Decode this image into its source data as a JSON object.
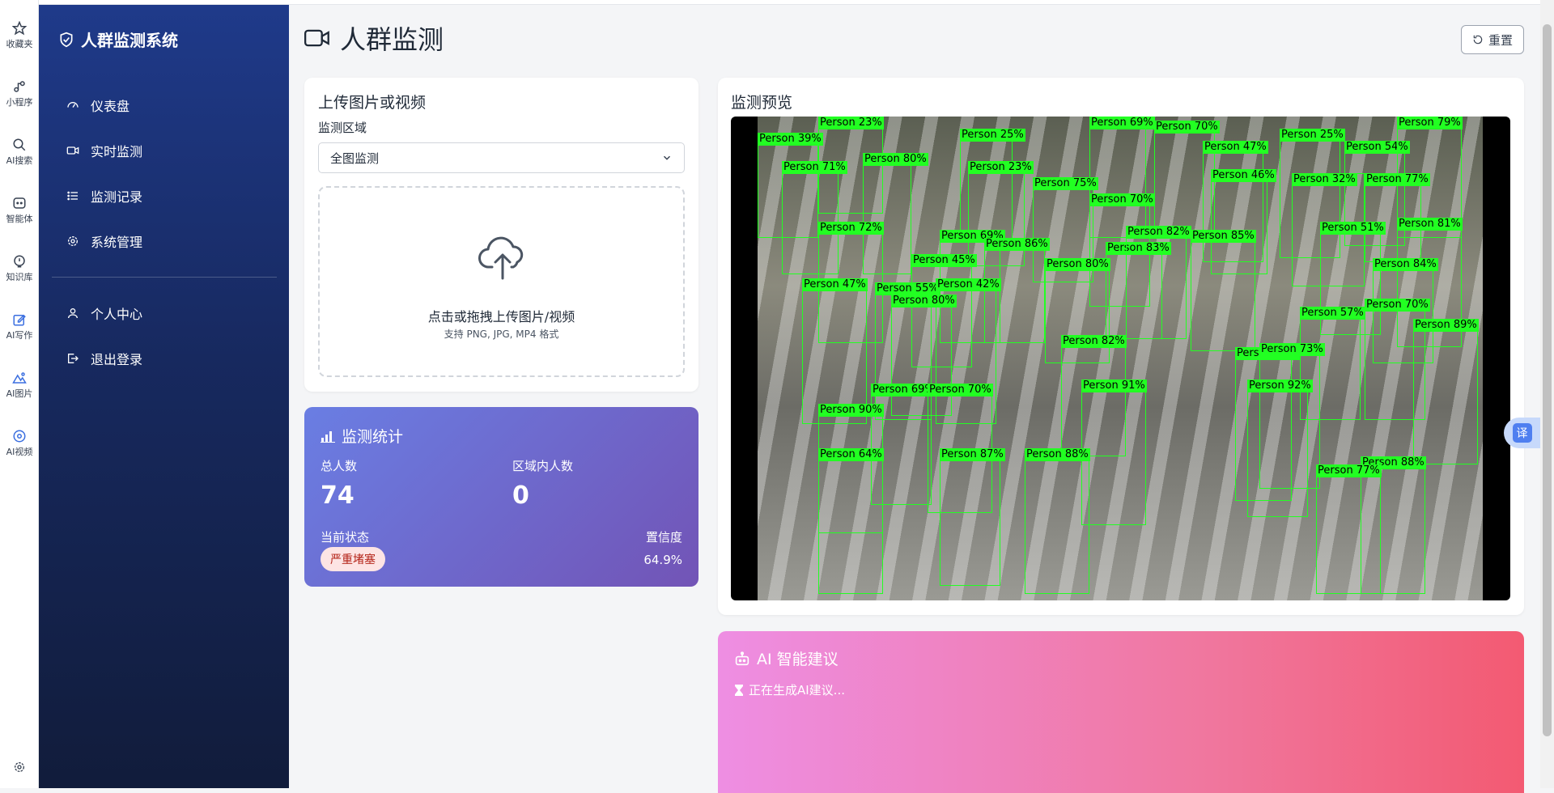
{
  "rail": {
    "items": [
      {
        "label": "收藏夹",
        "icon": "star-icon"
      },
      {
        "label": "小程序",
        "icon": "miniprogram-icon"
      },
      {
        "label": "AI搜索",
        "icon": "search-icon"
      },
      {
        "label": "智能体",
        "icon": "agent-icon"
      },
      {
        "label": "知识库",
        "icon": "knowledge-icon"
      },
      {
        "label": "AI写作",
        "icon": "write-icon"
      },
      {
        "label": "AI图片",
        "icon": "image-icon"
      },
      {
        "label": "AI视频",
        "icon": "video-icon"
      }
    ],
    "settings_icon": "gear-icon"
  },
  "sidebar": {
    "brand": "人群监测系统",
    "items": [
      {
        "label": "仪表盘",
        "icon": "dashboard-icon"
      },
      {
        "label": "实时监测",
        "icon": "camera-icon"
      },
      {
        "label": "监测记录",
        "icon": "list-icon"
      },
      {
        "label": "系统管理",
        "icon": "gear-icon"
      }
    ],
    "bottom_items": [
      {
        "label": "个人中心",
        "icon": "user-icon"
      },
      {
        "label": "退出登录",
        "icon": "logout-icon"
      }
    ]
  },
  "header": {
    "title": "人群监测",
    "reset_label": "重置"
  },
  "upload": {
    "title": "上传图片或视频",
    "region_label": "监测区域",
    "region_value": "全图监测",
    "drop_main": "点击或拖拽上传图片/视频",
    "drop_sub": "支持 PNG, JPG, MP4 格式"
  },
  "stats": {
    "title": "监测统计",
    "total_label": "总人数",
    "total_value": "74",
    "region_label": "区域内人数",
    "region_value": "0",
    "status_label": "当前状态",
    "status_value": "严重堵塞",
    "confidence_label": "置信度",
    "confidence_value": "64.9%"
  },
  "preview": {
    "title": "监测预览",
    "detections": [
      {
        "label": "Person 23%"
      },
      {
        "label": "Person 39%"
      },
      {
        "label": "Person 71%"
      },
      {
        "label": "Person 80%"
      },
      {
        "label": "Person 25%"
      },
      {
        "label": "Person 23%"
      },
      {
        "label": "Person 69%"
      },
      {
        "label": "Person 70%"
      },
      {
        "label": "Person 47%"
      },
      {
        "label": "Person 25%"
      },
      {
        "label": "Person 54%"
      },
      {
        "label": "Person 79%"
      },
      {
        "label": "Person 46%"
      },
      {
        "label": "Person 32%"
      },
      {
        "label": "Person 77%"
      },
      {
        "label": "Person 75%"
      },
      {
        "label": "Person 70%"
      },
      {
        "label": "Person 83%"
      },
      {
        "label": "Person 72%"
      },
      {
        "label": "Person 69%"
      },
      {
        "label": "Person 86%"
      },
      {
        "label": "Person 82%"
      },
      {
        "label": "Person 85%"
      },
      {
        "label": "Person 51%"
      },
      {
        "label": "Person 81%"
      },
      {
        "label": "Person 45%"
      },
      {
        "label": "Person 80%"
      },
      {
        "label": "Person 84%"
      },
      {
        "label": "Person 47%"
      },
      {
        "label": "Person 55%"
      },
      {
        "label": "Person 42%"
      },
      {
        "label": "Person 80%"
      },
      {
        "label": "Person 70%"
      },
      {
        "label": "Person 57%"
      },
      {
        "label": "Person 89%"
      },
      {
        "label": "Person 82%"
      },
      {
        "label": "Person 37%"
      },
      {
        "label": "Person 73%"
      },
      {
        "label": "Person 91%"
      },
      {
        "label": "Person 92%"
      },
      {
        "label": "Person 69%"
      },
      {
        "label": "Person 70%"
      },
      {
        "label": "Person 90%"
      },
      {
        "label": "Person 64%"
      },
      {
        "label": "Person 87%"
      },
      {
        "label": "Person 88%"
      },
      {
        "label": "Person 88%"
      },
      {
        "label": "Person 77%"
      }
    ]
  },
  "ai": {
    "title": "AI 智能建议",
    "status": "正在生成AI建议..."
  },
  "translate": {
    "label": "译"
  }
}
